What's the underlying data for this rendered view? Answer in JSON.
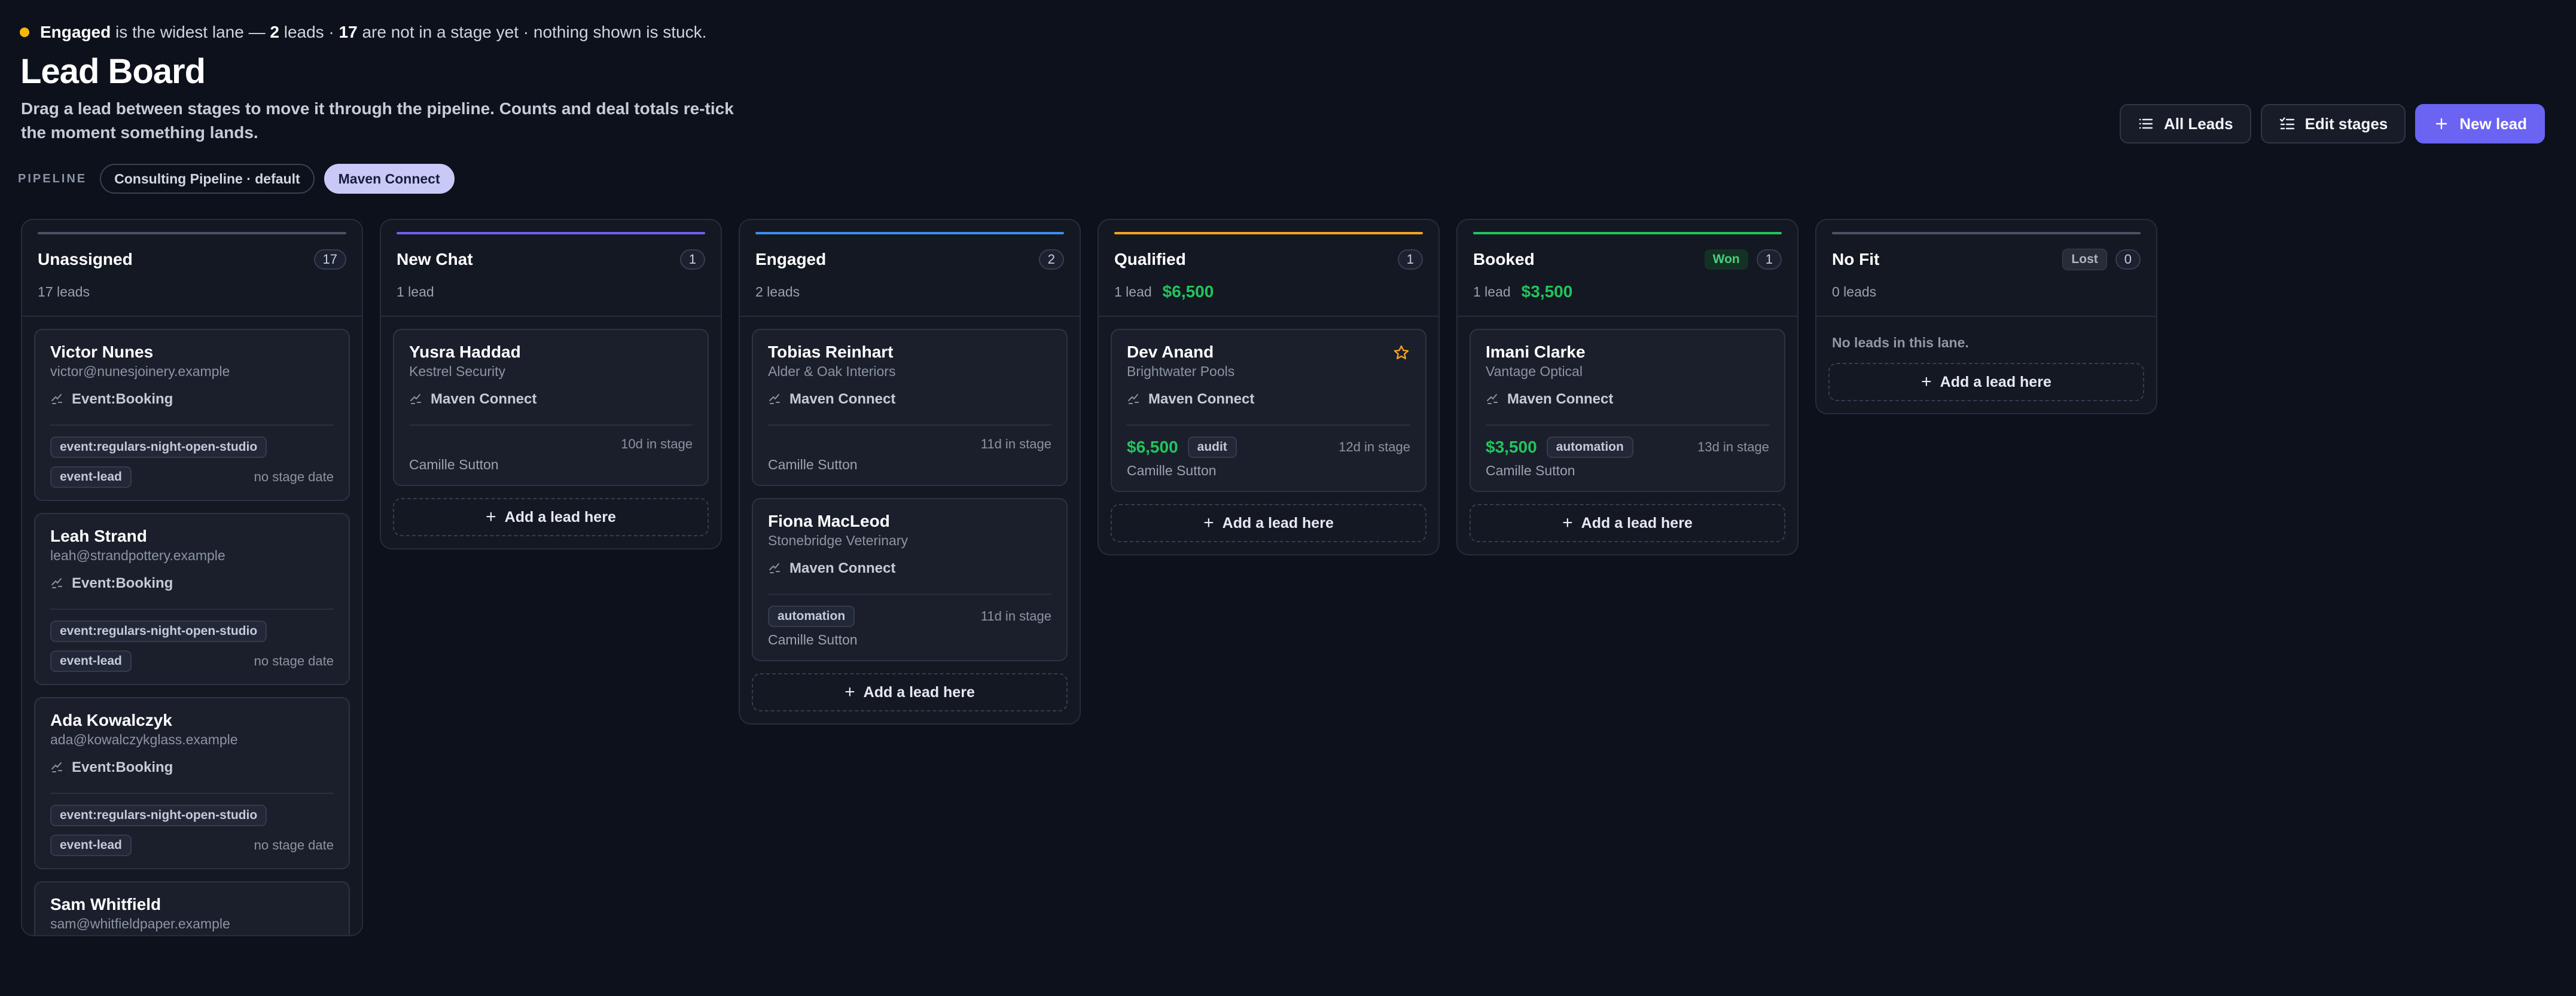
{
  "summary": {
    "lane": "Engaged",
    "text_a": " is the widest lane — ",
    "leads": "2",
    "text_b": " leads · ",
    "unstaged": "17",
    "text_c": " are not in a stage yet · nothing shown is stuck."
  },
  "page": {
    "title": "Lead Board",
    "description": "Drag a lead between stages to move it through the pipeline. Counts and deal totals re-tick the moment something lands."
  },
  "pipeline": {
    "label": "PIPELINE",
    "chips": [
      "Consulting Pipeline · default",
      "Maven Connect"
    ],
    "active": "Maven Connect"
  },
  "actions": {
    "all_leads": "All Leads",
    "edit_stages": "Edit stages",
    "new_lead": "New lead"
  },
  "colors": {
    "accent": "#6b63f2",
    "money": "#23c45e",
    "new_chat": "#6b63f2",
    "engaged": "#3b8ff0",
    "qualified": "#f5a524",
    "booked": "#22c55e",
    "neutral": "#4b5263"
  },
  "add_label": "Add a lead here",
  "lanes": {
    "unassigned": {
      "name": "Unassigned",
      "badge": "17",
      "count": "17 leads",
      "cards": [
        {
          "name": "Victor Nunes",
          "sub": "victor@nunesjoinery.example",
          "source": "Event:Booking",
          "tag1": "event:regulars-night-open-studio",
          "tag2": "event-lead",
          "stage": "no stage date"
        },
        {
          "name": "Leah Strand",
          "sub": "leah@strandpottery.example",
          "source": "Event:Booking",
          "tag1": "event:regulars-night-open-studio",
          "tag2": "event-lead",
          "stage": "no stage date"
        },
        {
          "name": "Ada Kowalczyk",
          "sub": "ada@kowalczykglass.example",
          "source": "Event:Booking",
          "tag1": "event:regulars-night-open-studio",
          "tag2": "event-lead",
          "stage": "no stage date"
        },
        {
          "name": "Sam Whitfield",
          "sub": "sam@whitfieldpaper.example"
        }
      ]
    },
    "new_chat": {
      "name": "New Chat",
      "badge": "1",
      "count": "1 lead",
      "cards": [
        {
          "name": "Yusra Haddad",
          "sub": "Kestrel Security",
          "source": "Maven Connect",
          "stage": "10d in stage",
          "owner": "Camille Sutton"
        }
      ]
    },
    "engaged": {
      "name": "Engaged",
      "badge": "2",
      "count": "2 leads",
      "cards": [
        {
          "name": "Tobias Reinhart",
          "sub": "Alder & Oak Interiors",
          "source": "Maven Connect",
          "stage": "11d in stage",
          "owner": "Camille Sutton"
        },
        {
          "name": "Fiona MacLeod",
          "sub": "Stonebridge Veterinary",
          "source": "Maven Connect",
          "tag": "automation",
          "stage": "11d in stage",
          "owner": "Camille Sutton"
        }
      ]
    },
    "qualified": {
      "name": "Qualified",
      "badge": "1",
      "count": "1 lead",
      "total": "$6,500",
      "cards": [
        {
          "name": "Dev Anand",
          "sub": "Brightwater Pools",
          "source": "Maven Connect",
          "deal": "$6,500",
          "tag": "audit",
          "stage": "12d in stage",
          "owner": "Camille Sutton"
        }
      ]
    },
    "booked": {
      "name": "Booked",
      "status": "Won",
      "badge": "1",
      "count": "1 lead",
      "total": "$3,500",
      "cards": [
        {
          "name": "Imani Clarke",
          "sub": "Vantage Optical",
          "source": "Maven Connect",
          "deal": "$3,500",
          "tag": "automation",
          "stage": "13d in stage",
          "owner": "Camille Sutton"
        }
      ]
    },
    "no_fit": {
      "name": "No Fit",
      "status": "Lost",
      "badge": "0",
      "count": "0 leads",
      "empty": "No leads in this lane."
    }
  }
}
